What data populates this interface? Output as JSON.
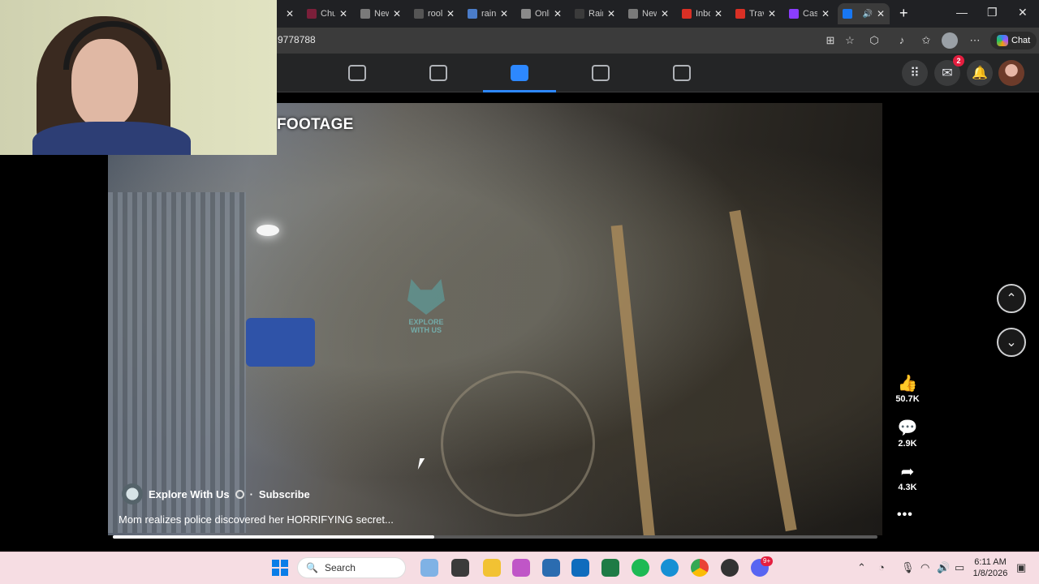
{
  "browser": {
    "tabs": [
      {
        "label": "",
        "favicon": "tab-icon",
        "active": false,
        "color": "#9b9b9b"
      },
      {
        "label": "Chu",
        "favicon": "tab-icon",
        "active": false,
        "color": "#7b1f3a"
      },
      {
        "label": "New",
        "favicon": "new-tab-icon",
        "active": false,
        "color": "#7a7a7a"
      },
      {
        "label": "rool",
        "favicon": "search-icon",
        "active": false,
        "color": "#555"
      },
      {
        "label": "raini",
        "favicon": "search-icon",
        "active": false,
        "color": "#4a7cc9"
      },
      {
        "label": "Onli",
        "favicon": "tab-icon",
        "active": false,
        "color": "#8a8a8a"
      },
      {
        "label": "Rain",
        "favicon": "tab-icon",
        "active": false,
        "color": "#3b3b3b"
      },
      {
        "label": "New",
        "favicon": "new-tab-icon",
        "active": false,
        "color": "#7a7a7a"
      },
      {
        "label": "Inbo",
        "favicon": "gmail-icon",
        "active": false,
        "color": "#d93025"
      },
      {
        "label": "Travi",
        "favicon": "gmail-icon",
        "active": false,
        "color": "#d93025"
      },
      {
        "label": "Cash",
        "favicon": "canva-icon",
        "active": false,
        "color": "#8b3dff"
      },
      {
        "label": "",
        "favicon": "facebook-icon",
        "active": true,
        "color": "#1877f2"
      }
    ],
    "url": "9778788",
    "chat_label": "Chat"
  },
  "facebook": {
    "messenger_badge": "2"
  },
  "video": {
    "overlay_text": "FOOTAGE",
    "watermark": "EXPLORE WITH US",
    "channel_name": "Explore With Us",
    "separator": "·",
    "subscribe_label": "Subscribe",
    "caption": "Mom realizes police discovered her HORRIFYING secret...",
    "progress": 0.42,
    "likes": "50.7K",
    "comments": "2.9K",
    "shares": "4.3K"
  },
  "taskbar": {
    "search_placeholder": "Search",
    "discord_badge": "9+",
    "time": "6:11 AM",
    "date": "1/8/2026"
  },
  "colors": {
    "facebook_blue": "#2d88ff",
    "taskbar_bg": "#f6dde3",
    "badge_red": "#e41e3f"
  }
}
